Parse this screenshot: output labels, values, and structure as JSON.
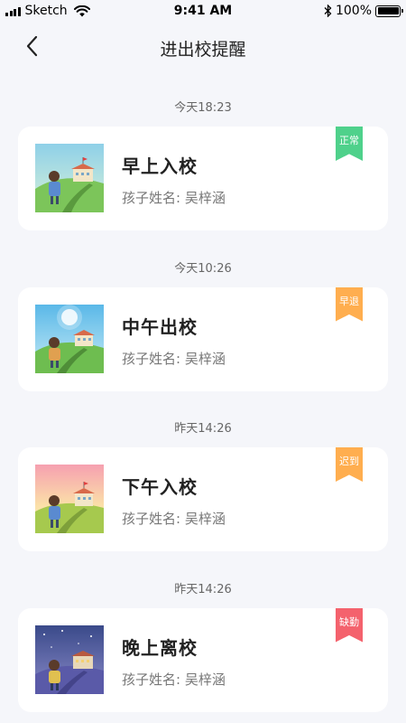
{
  "status_bar": {
    "carrier": "Sketch",
    "time": "9:41 AM",
    "battery": "100%"
  },
  "nav": {
    "title": "进出校提醒",
    "back_icon": "chevron-left-icon"
  },
  "child_label": "孩子姓名:",
  "entries": [
    {
      "time": "今天18:23",
      "title": "早上入校",
      "child_name": "吴梓涵",
      "status": "正常",
      "status_color": "#4fd18b",
      "scene": "morning"
    },
    {
      "time": "今天10:26",
      "title": "中午出校",
      "child_name": "吴梓涵",
      "status": "早退",
      "status_color": "#ffae4f",
      "scene": "noon"
    },
    {
      "time": "昨天14:26",
      "title": "下午入校",
      "child_name": "吴梓涵",
      "status": "迟到",
      "status_color": "#ffae4f",
      "scene": "afternoon"
    },
    {
      "time": "昨天14:26",
      "title": "晚上离校",
      "child_name": "吴梓涵",
      "status": "缺勤",
      "status_color": "#f4626d",
      "scene": "night"
    }
  ]
}
